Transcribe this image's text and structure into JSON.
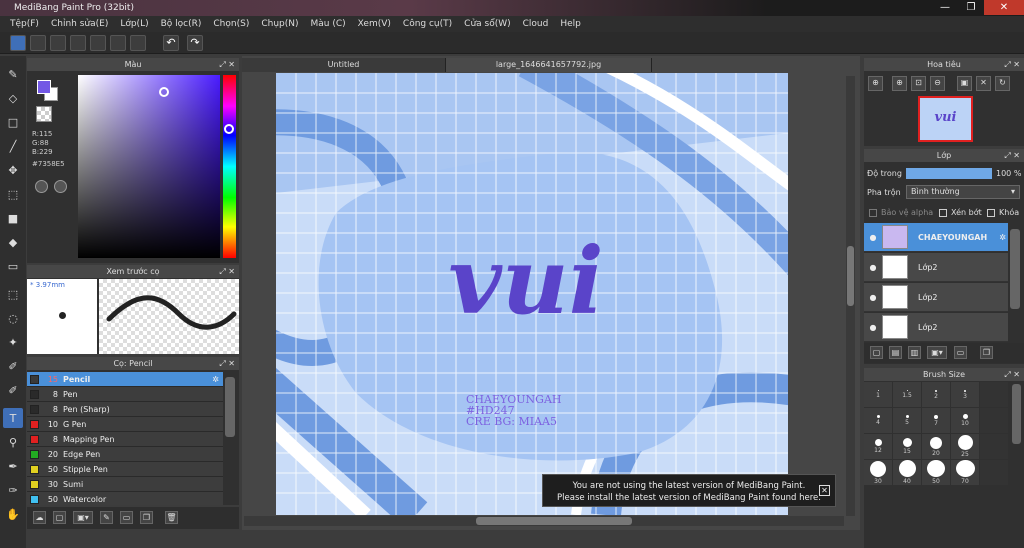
{
  "window": {
    "title": "MediBang Paint Pro (32bit)",
    "minimize": "—",
    "restore": "❐",
    "close": "✕"
  },
  "menu": [
    "Tệp(F)",
    "Chỉnh sửa(E)",
    "Lớp(L)",
    "Bộ lọc(R)",
    "Chọn(S)",
    "Chụp(N)",
    "Màu (C)",
    "Xem(V)",
    "Công cụ(T)",
    "Cửa sổ(W)",
    "Cloud",
    "Help"
  ],
  "color_panel": {
    "title": "Màu",
    "r": "R:115",
    "g": "G:88",
    "b": "B:229",
    "hex": "#7358E5",
    "fg_color": "#7358E5"
  },
  "preview_panel": {
    "title": "Xem trước cọ",
    "size": "3.97mm"
  },
  "brush_panel": {
    "title": "Cọ: Pencil",
    "brushes": [
      {
        "size": "15",
        "name": "Pencil",
        "color": "#3a3a3a",
        "selected": true
      },
      {
        "size": "8",
        "name": "Pen",
        "color": "#2a2a2a"
      },
      {
        "size": "8",
        "name": "Pen (Sharp)",
        "color": "#2a2a2a"
      },
      {
        "size": "10",
        "name": "G Pen",
        "color": "#e02020"
      },
      {
        "size": "8",
        "name": "Mapping Pen",
        "color": "#e02020"
      },
      {
        "size": "20",
        "name": "Edge Pen",
        "color": "#22aa22"
      },
      {
        "size": "50",
        "name": "Stipple Pen",
        "color": "#e0d020"
      },
      {
        "size": "30",
        "name": "Sumi",
        "color": "#e0d020"
      },
      {
        "size": "50",
        "name": "Watercolor",
        "color": "#40c0f0"
      }
    ]
  },
  "tabs": {
    "tab1": "Untitled",
    "tab2": "large_1646641657792.jpg"
  },
  "artwork": {
    "main_text": "vui",
    "caption_line1": "CHAEYOUNGAH",
    "caption_line2": "#HD247",
    "caption_line3": "CRE BG: MIAA5"
  },
  "navigator": {
    "title": "Hoa tiêu",
    "thumb_text": "vui"
  },
  "layer_panel": {
    "title": "Lớp",
    "opacity_label": "Độ trong",
    "opacity_value": "100 %",
    "blend_label": "Pha trộn",
    "blend_value": "Bình thường",
    "protect_alpha": "Bảo vệ alpha",
    "clipping": "Xén bớt",
    "lock": "Khóa",
    "layers": [
      {
        "name": "CHAEYOUNGAH",
        "selected": true
      },
      {
        "name": "Lớp2"
      },
      {
        "name": "Lớp2"
      },
      {
        "name": "Lớp2"
      }
    ]
  },
  "brush_size_panel": {
    "title": "Brush Size",
    "sizes": [
      "1",
      "1.5",
      "2",
      "3",
      "",
      "4",
      "5",
      "7",
      "10",
      "",
      "12",
      "15",
      "20",
      "25",
      "",
      "30",
      "40",
      "50",
      "70",
      ""
    ]
  },
  "toast": {
    "line1": "You are not using the latest version of MediBang Paint.",
    "line2": "Please install the latest version of MediBang Paint found here.",
    "close": "✕"
  }
}
